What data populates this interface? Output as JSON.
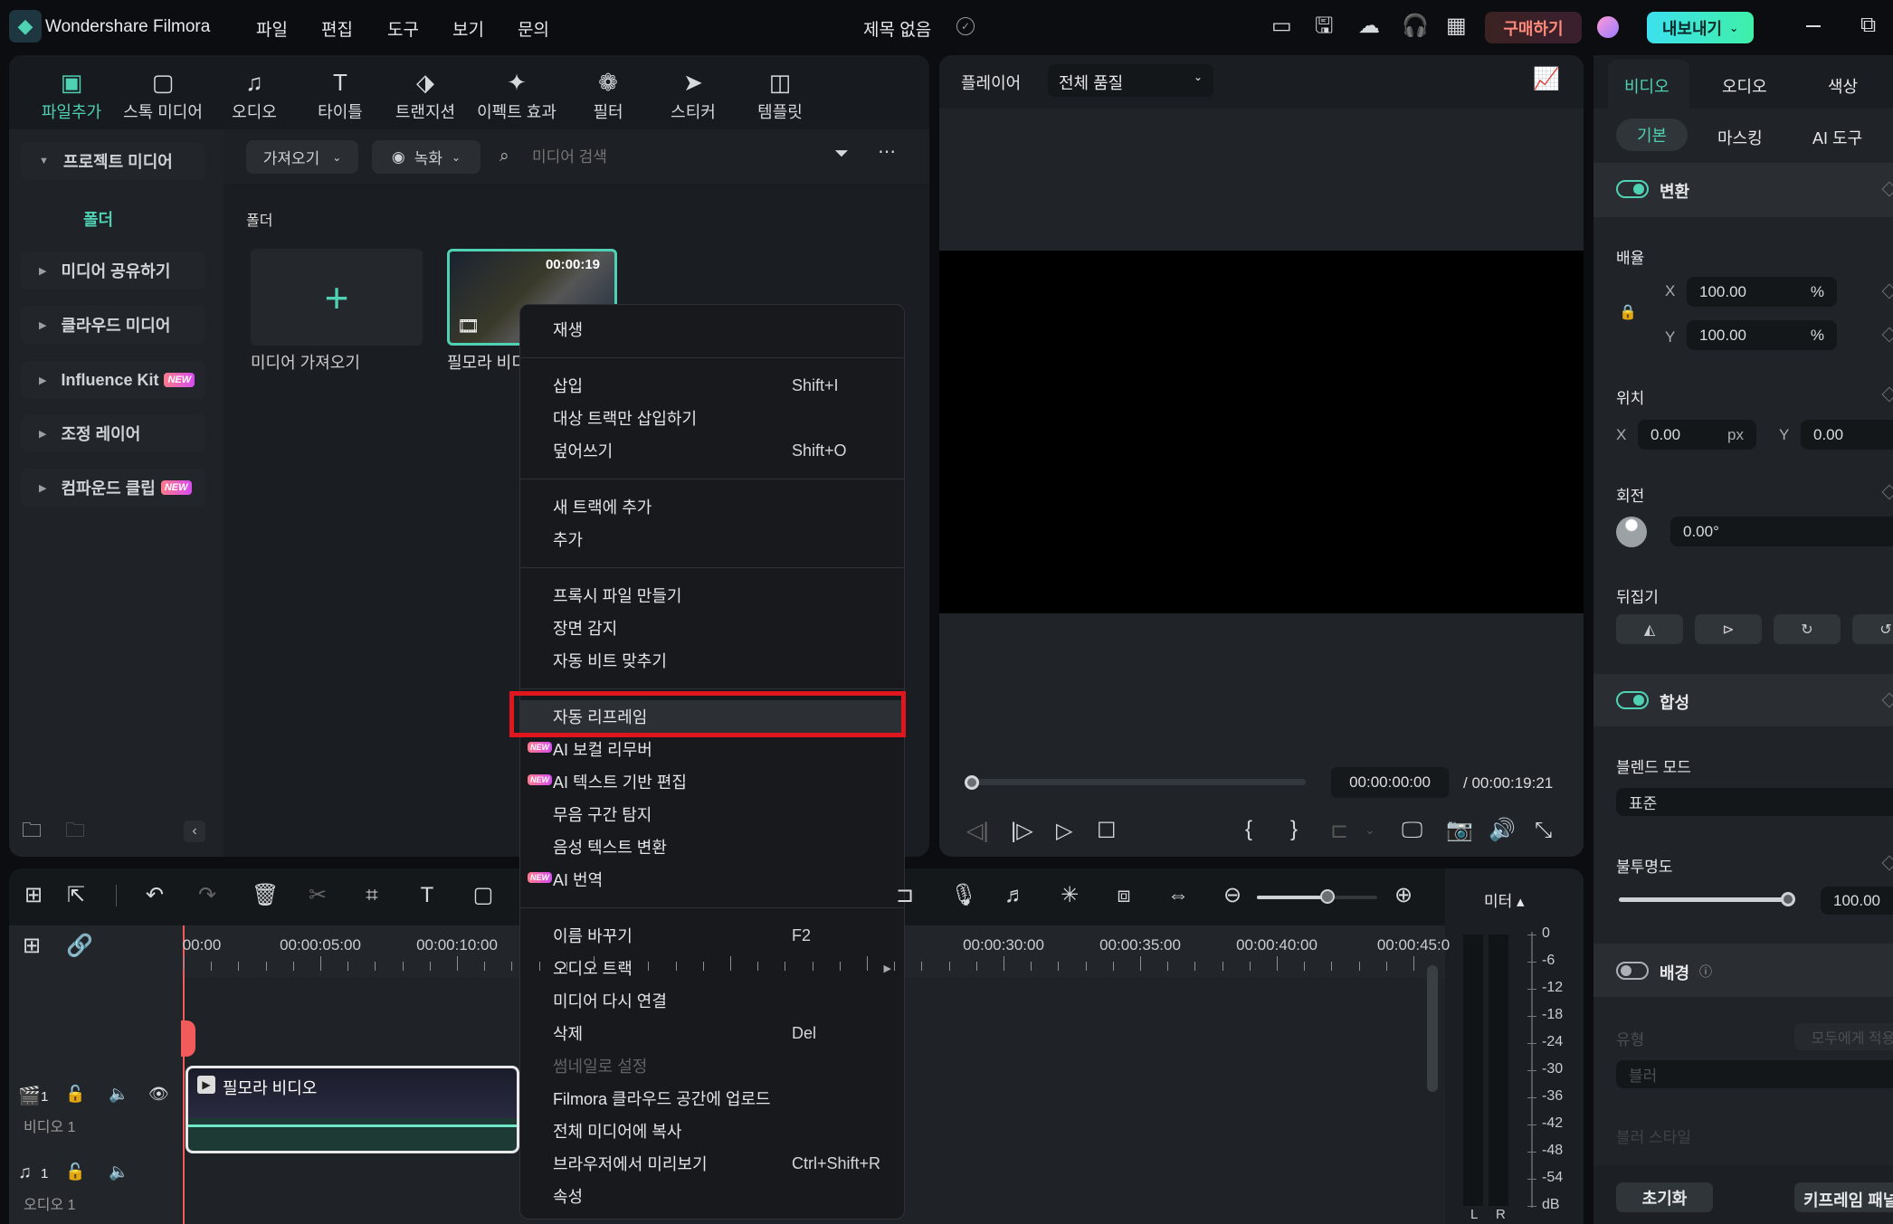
{
  "app": {
    "name": "Wondershare Filmora",
    "menus": [
      "파일",
      "편집",
      "도구",
      "보기",
      "문의"
    ],
    "project_title": "제목 없음",
    "buy_label": "구매하기",
    "export_label": "내보내기",
    "accent": "#4fd1b3",
    "highlight_color": "#e0161e"
  },
  "toolbar_tabs": [
    {
      "label": "파일추가",
      "icon": "media-icon",
      "active": true
    },
    {
      "label": "스톡 미디어",
      "icon": "stock-media-icon"
    },
    {
      "label": "오디오",
      "icon": "music-note-icon"
    },
    {
      "label": "타이틀",
      "icon": "title-t-icon"
    },
    {
      "label": "트랜지션",
      "icon": "transition-icon"
    },
    {
      "label": "이펙트 효과",
      "icon": "effects-star-icon"
    },
    {
      "label": "필터",
      "icon": "filter-icon"
    },
    {
      "label": "스티커",
      "icon": "sticker-icon"
    },
    {
      "label": "템플릿",
      "icon": "template-icon"
    }
  ],
  "sidebar": {
    "items": [
      {
        "label": "프로젝트 미디어",
        "expanded": true
      },
      {
        "label": "폴더",
        "sub": true,
        "active": true
      },
      {
        "label": "미디어 공유하기"
      },
      {
        "label": "클라우드 미디어"
      },
      {
        "label": "Influence Kit",
        "new": "NEW"
      },
      {
        "label": "조정 레이어"
      },
      {
        "label": "컴파운드 클립",
        "new": "NEW"
      }
    ]
  },
  "media": {
    "import_label": "가져오기",
    "record_label": "녹화",
    "search_placeholder": "미디어 검색",
    "folder_label": "폴더",
    "import_tile_label": "미디어 가져오기",
    "clip_label": "필모라 비디오",
    "clip_duration": "00:00:19"
  },
  "player": {
    "title": "플레이어",
    "quality": "전체 품질",
    "current_time": "00:00:00:00",
    "total_time": "/ 00:00:19:21",
    "progress": 0
  },
  "context_menu": [
    {
      "label": "재생"
    },
    {
      "sep": true
    },
    {
      "label": "삽입",
      "shortcut": "Shift+I"
    },
    {
      "label": "대상 트랙만 삽입하기"
    },
    {
      "label": "덮어쓰기",
      "shortcut": "Shift+O"
    },
    {
      "sep": true
    },
    {
      "label": "새 트랙에 추가"
    },
    {
      "label": "추가"
    },
    {
      "sep": true
    },
    {
      "label": "프록시 파일 만들기"
    },
    {
      "label": "장면 감지"
    },
    {
      "label": "자동 비트 맞추기"
    },
    {
      "sep": true
    },
    {
      "label": "자동 리프레임",
      "highlighted": true
    },
    {
      "label": "AI 보컬 리무버",
      "new": "NEW"
    },
    {
      "label": "AI 텍스트 기반 편집",
      "new": "NEW"
    },
    {
      "label": "무음 구간 탐지"
    },
    {
      "label": "음성 텍스트 변환"
    },
    {
      "label": "AI 번역",
      "new": "NEW"
    },
    {
      "sep": true
    },
    {
      "label": "이름 바꾸기",
      "shortcut": "F2"
    },
    {
      "label": "오디오 트랙",
      "submenu": true
    },
    {
      "label": "미디어 다시 연결"
    },
    {
      "label": "삭제",
      "shortcut": "Del"
    },
    {
      "label": "썸네일로 설정",
      "disabled": true
    },
    {
      "label": "Filmora 클라우드 공간에 업로드"
    },
    {
      "label": "전체 미디어에 복사"
    },
    {
      "label": "브라우저에서 미리보기",
      "shortcut": "Ctrl+Shift+R"
    },
    {
      "label": "속성"
    }
  ],
  "timeline": {
    "ruler": [
      {
        "s": 0,
        "label": "00:00"
      },
      {
        "s": 5,
        "label": "00:00:05:00"
      },
      {
        "s": 10,
        "label": "00:00:10:00"
      },
      {
        "s": 30,
        "label": "00:00:30:00"
      },
      {
        "s": 35,
        "label": "00:00:35:00"
      },
      {
        "s": 40,
        "label": "00:00:40:00"
      },
      {
        "s": 45,
        "label": "00:00:45:0"
      }
    ],
    "video_track": {
      "num": "1",
      "label": "비디오 1",
      "clip": "필모라 비디오"
    },
    "audio_track": {
      "num": "1",
      "label": "오디오 1"
    },
    "meter_label": "미터 ▴",
    "meter_scale": [
      "0",
      "-6",
      "-12",
      "-18",
      "-24",
      "-30",
      "-36",
      "-42",
      "-48",
      "-54",
      "dB"
    ],
    "meter_channels": [
      "L",
      "R"
    ],
    "zoom_level": 0.6
  },
  "inspector": {
    "tabs": [
      "비디오",
      "오디오",
      "색상"
    ],
    "subtabs": [
      "기본",
      "마스킹",
      "AI 도구"
    ],
    "transform": {
      "title": "변환",
      "scale_label": "배율",
      "scale_x": "100.00",
      "scale_y": "100.00",
      "unit_pct": "%",
      "position_label": "위치",
      "pos_x": "0.00",
      "pos_y": "0.00",
      "unit_px": "px",
      "rotation_label": "회전",
      "rotation": "0.00°",
      "flip_label": "뒤집기",
      "x": "X",
      "y": "Y"
    },
    "composite": {
      "title": "합성",
      "blend_label": "블렌드 모드",
      "blend": "표준",
      "opacity_label": "불투명도",
      "opacity": "100.00"
    },
    "background": {
      "title": "배경",
      "type_label": "유형",
      "apply_all": "모두에게 적용",
      "type_value": "블러",
      "blur_style_label": "블러 스타일"
    },
    "reset_label": "초기화",
    "keyframe_label": "키프레임 패널"
  }
}
